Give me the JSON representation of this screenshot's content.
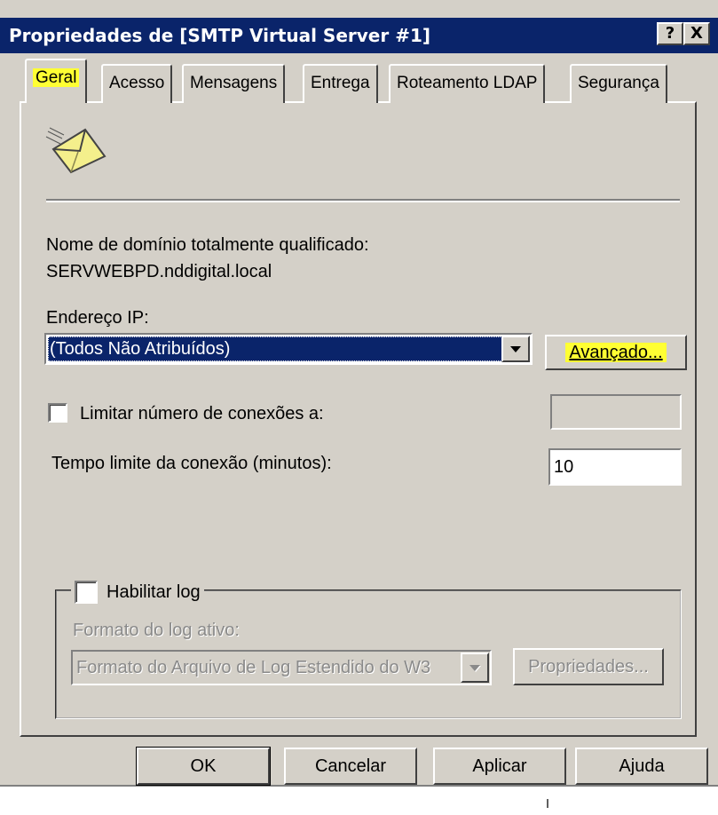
{
  "window": {
    "title": "Propriedades de [SMTP Virtual Server #1]",
    "help_button": "?",
    "close_button": "X"
  },
  "tabs": [
    {
      "label": "Geral",
      "active": true,
      "highlighted": true
    },
    {
      "label": "Acesso"
    },
    {
      "label": "Mensagens"
    },
    {
      "label": "Entrega"
    },
    {
      "label": "Roteamento LDAP"
    },
    {
      "label": "Segurança"
    }
  ],
  "general": {
    "icon": "envelope-icon",
    "fqdn_label": "Nome de domínio totalmente qualificado:",
    "fqdn_value": "SERVWEBPD.nddigital.local",
    "ip_label": "Endereço IP:",
    "ip_value": "(Todos Não Atribuídos)",
    "advanced_button": "Avançado...",
    "limit_connections_label": "Limitar número de conexões a:",
    "limit_connections_checked": false,
    "limit_connections_value": "",
    "timeout_label": "Tempo limite da conexão (minutos):",
    "timeout_value": "10"
  },
  "logging": {
    "enable_label": "Habilitar log",
    "enable_checked": false,
    "format_label": "Formato do log ativo:",
    "format_value": "Formato do Arquivo de Log Estendido do W3",
    "properties_button": "Propriedades..."
  },
  "buttons": {
    "ok": "OK",
    "cancel": "Cancelar",
    "apply": "Aplicar",
    "help": "Ajuda"
  },
  "colors": {
    "titlebar": "#0a246a",
    "dialog": "#d4d0c8",
    "highlight": "#ffff33"
  }
}
